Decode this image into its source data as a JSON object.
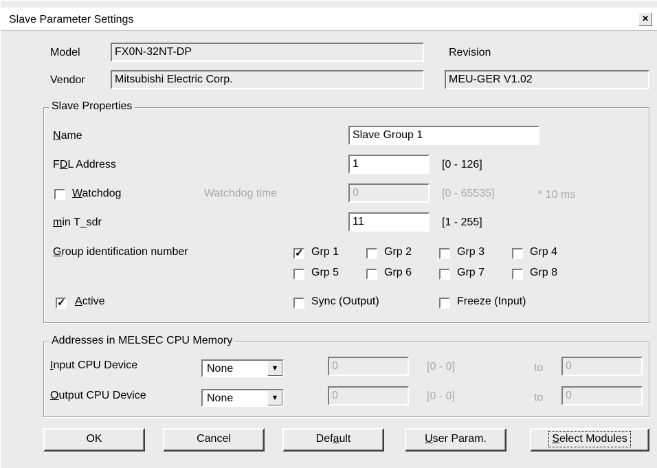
{
  "window": {
    "title": "Slave Parameter Settings",
    "close_label": "×"
  },
  "header": {
    "model_label": "Model",
    "model_value": "FX0N-32NT-DP",
    "vendor_label": "Vendor",
    "vendor_value": "Mitsubishi Electric Corp.",
    "revision_label": "Revision",
    "revision_value": "MEU-GER V1.02"
  },
  "slave_properties": {
    "caption": "Slave Properties",
    "name_label_pre": "",
    "name_label_u": "N",
    "name_label_post": "ame",
    "name_value": "Slave Group 1",
    "fdl_label_pre": "F",
    "fdl_label_u": "D",
    "fdl_label_post": "L Address",
    "fdl_value": "1",
    "fdl_range": "[0 - 126]",
    "watchdog_u": "W",
    "watchdog_post": "atchdog",
    "watchdog_checked": false,
    "watchdog_time_label": "Watchdog time",
    "watchdog_time_value": "0",
    "watchdog_range": "[0 - 65535]",
    "watchdog_unit": "* 10 ms",
    "min_tsdr_u": "m",
    "min_tsdr_post": "in T_sdr",
    "min_tsdr_value": "11",
    "min_tsdr_range": "[1 - 255]",
    "group_label_u": "G",
    "group_label_post": "roup identification number",
    "groups": [
      {
        "label": "Grp 1",
        "checked": true
      },
      {
        "label": "Grp 2",
        "checked": false
      },
      {
        "label": "Grp 3",
        "checked": false
      },
      {
        "label": "Grp 4",
        "checked": false
      },
      {
        "label": "Grp 5",
        "checked": false
      },
      {
        "label": "Grp 6",
        "checked": false
      },
      {
        "label": "Grp 7",
        "checked": false
      },
      {
        "label": "Grp 8",
        "checked": false
      }
    ],
    "active_u": "A",
    "active_post": "ctive",
    "active_checked": true,
    "sync_label": "Sync (Output)",
    "sync_checked": false,
    "freeze_label": "Freeze (Input)",
    "freeze_checked": false,
    "check_mark": "✓"
  },
  "addresses": {
    "caption": "Addresses in MELSEC CPU Memory",
    "input_u": "I",
    "input_post": "nput CPU Device",
    "input_device": "None",
    "input_start": "0",
    "input_range": "[0 - 0]",
    "input_to": "to",
    "input_end": "0",
    "output_u": "O",
    "output_post": "utput CPU Device",
    "output_device": "None",
    "output_start": "0",
    "output_range": "[0 - 0]",
    "output_to": "to",
    "output_end": "0",
    "dropdown_arrow": "▼"
  },
  "buttons": {
    "ok": "OK",
    "cancel": "Cancel",
    "default_pre": "Def",
    "default_u": "a",
    "default_post": "ult",
    "user_u": "U",
    "user_post": "ser Param.",
    "select_u": "S",
    "select_post": "elect Modules"
  }
}
